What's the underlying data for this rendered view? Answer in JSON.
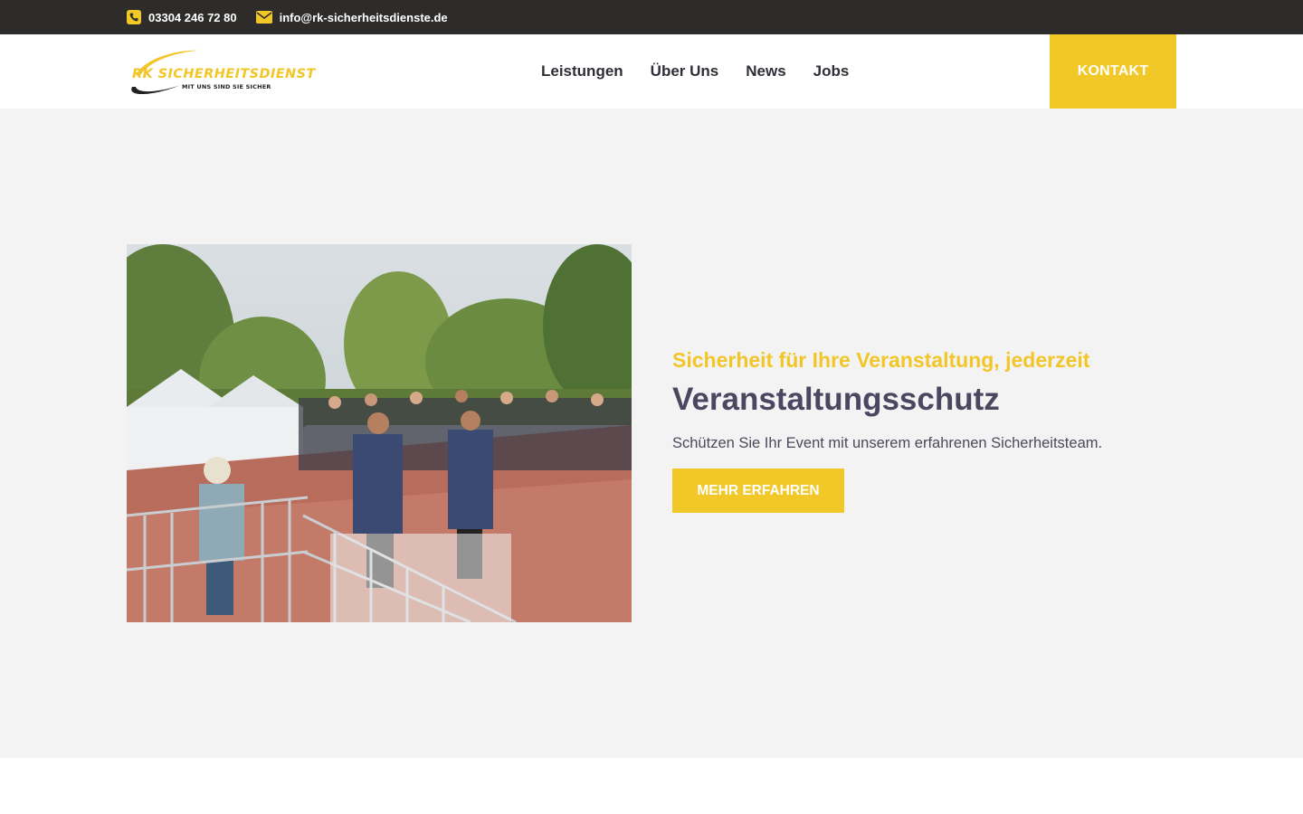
{
  "topbar": {
    "phone": "03304 246 72 80",
    "email": "info@rk-sicherheitsdienste.de",
    "phone_icon": "phone-icon",
    "email_icon": "envelope-icon"
  },
  "logo": {
    "brand": "RK SICHERHEITSDIENST",
    "tagline": "MIT UNS SIND SIE SICHER"
  },
  "nav": {
    "items": [
      {
        "label": "Leistungen"
      },
      {
        "label": "Über Uns"
      },
      {
        "label": "News"
      },
      {
        "label": "Jobs"
      }
    ],
    "cta_label": "KONTAKT"
  },
  "hero": {
    "eyebrow": "Sicherheit für Ihre Veranstaltung, jederzeit",
    "title": "Veranstaltungsschutz",
    "description": "Schützen Sie Ihr Event mit unserem erfahrenen Sicherheitsteam.",
    "button_label": "MEHR ERFAHREN"
  },
  "colors": {
    "accent": "#f2c828",
    "topbar": "#2d2c2a",
    "hero_bg": "#f3f3f3",
    "heading": "#4a4860"
  }
}
